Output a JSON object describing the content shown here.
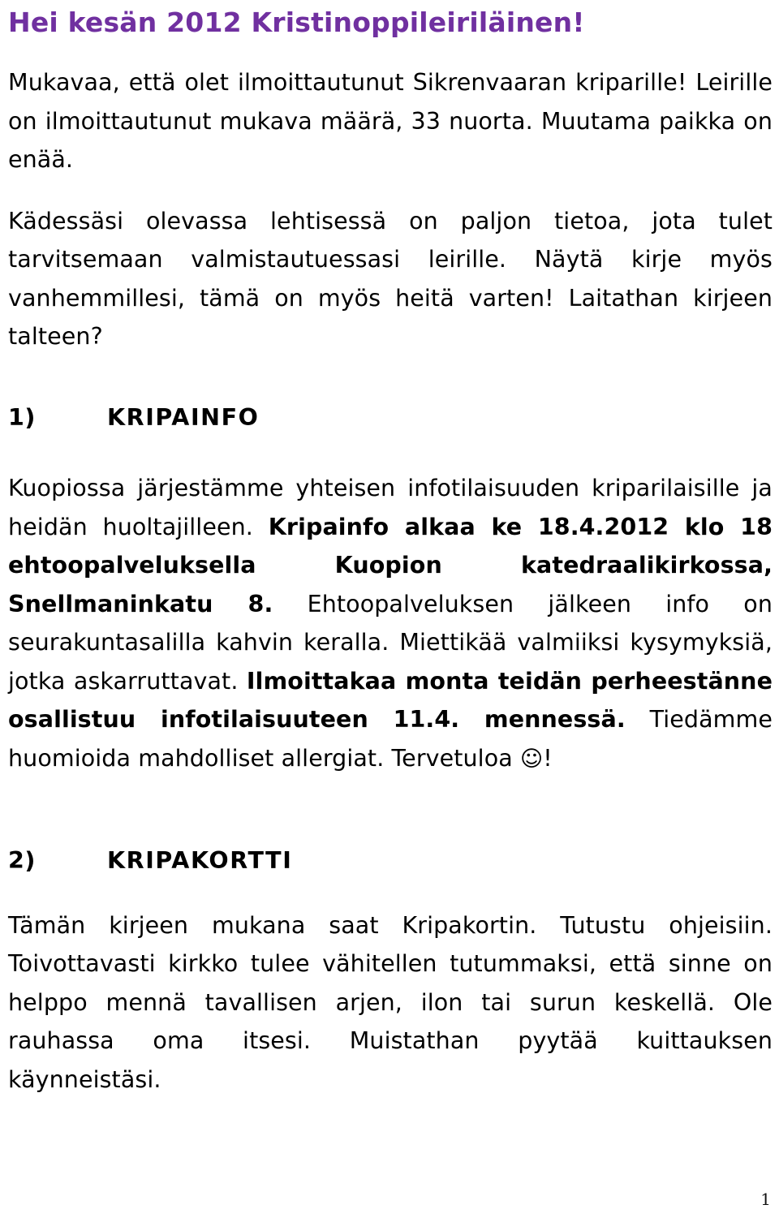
{
  "document": {
    "title": "Hei kesän 2012 Kristinoppileiriläinen!",
    "title_color": "#7030A0",
    "page_number": "1"
  },
  "intro": {
    "paragraph_1": "Mukavaa, että olet ilmoittautunut Sikrenvaaran kriparille! Leirille on ilmoittautunut mukava määrä, 33 nuorta. Muutama paikka on enää.",
    "paragraph_2": "Kädessäsi olevassa lehtisessä on paljon tietoa, jota tulet tarvitsemaan valmistautuessasi leirille. Näytä kirje myös vanhemmillesi, tämä on myös heitä varten! Laitathan kirjeen talteen?"
  },
  "sections": [
    {
      "number": "1)",
      "label": "KRIPAINFO",
      "body": {
        "part_1": "Kuopiossa järjestämme yhteisen infotilaisuuden kriparilaisille ja heidän huoltajilleen. ",
        "bold_1": "Kripainfo alkaa ke 18.4.2012 klo 18 ehtoopalveluksella Kuopion katedraalikirkossa, Snellmaninkatu 8.",
        "part_2": " Ehtoopalveluksen jälkeen info on seurakuntasalilla kahvin keralla. Miettikää valmiiksi kysymyksiä, jotka askarruttavat. ",
        "bold_2": "Ilmoittakaa monta teidän perheestänne osallistuu infotilaisuuteen 11.4. mennessä.",
        "part_3": " Tiedämme huomioida mahdolliset allergiat. Tervetuloa ",
        "smiley": "☺",
        "part_4": "!"
      }
    },
    {
      "number": "2)",
      "label": "KRIPAKORTTI",
      "body": {
        "part_1": "Tämän kirjeen mukana saat Kripakortin. Tutustu ohjeisiin. Toivottavasti kirkko tulee vähitellen tutummaksi, että sinne on helppo mennä tavallisen arjen, ilon tai surun keskellä. Ole rauhassa oma itsesi. Muistathan pyytää kuittauksen käynneistäsi."
      }
    }
  ]
}
